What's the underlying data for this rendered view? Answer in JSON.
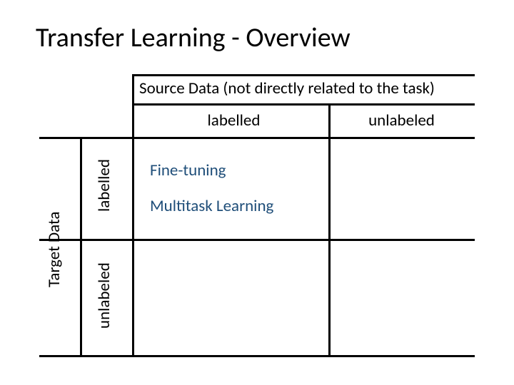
{
  "title": "Transfer Learning - Overview",
  "source_header": "Source Data (not directly related to the task)",
  "cols": {
    "labelled": "labelled",
    "unlabeled": "unlabeled"
  },
  "rows": {
    "target_data": "Target Data",
    "labelled": "labelled",
    "unlabeled": "unlabeled"
  },
  "cells": {
    "tl_main": {
      "fine_tuning": "Fine-tuning",
      "multitask": "Multitask Learning"
    }
  }
}
